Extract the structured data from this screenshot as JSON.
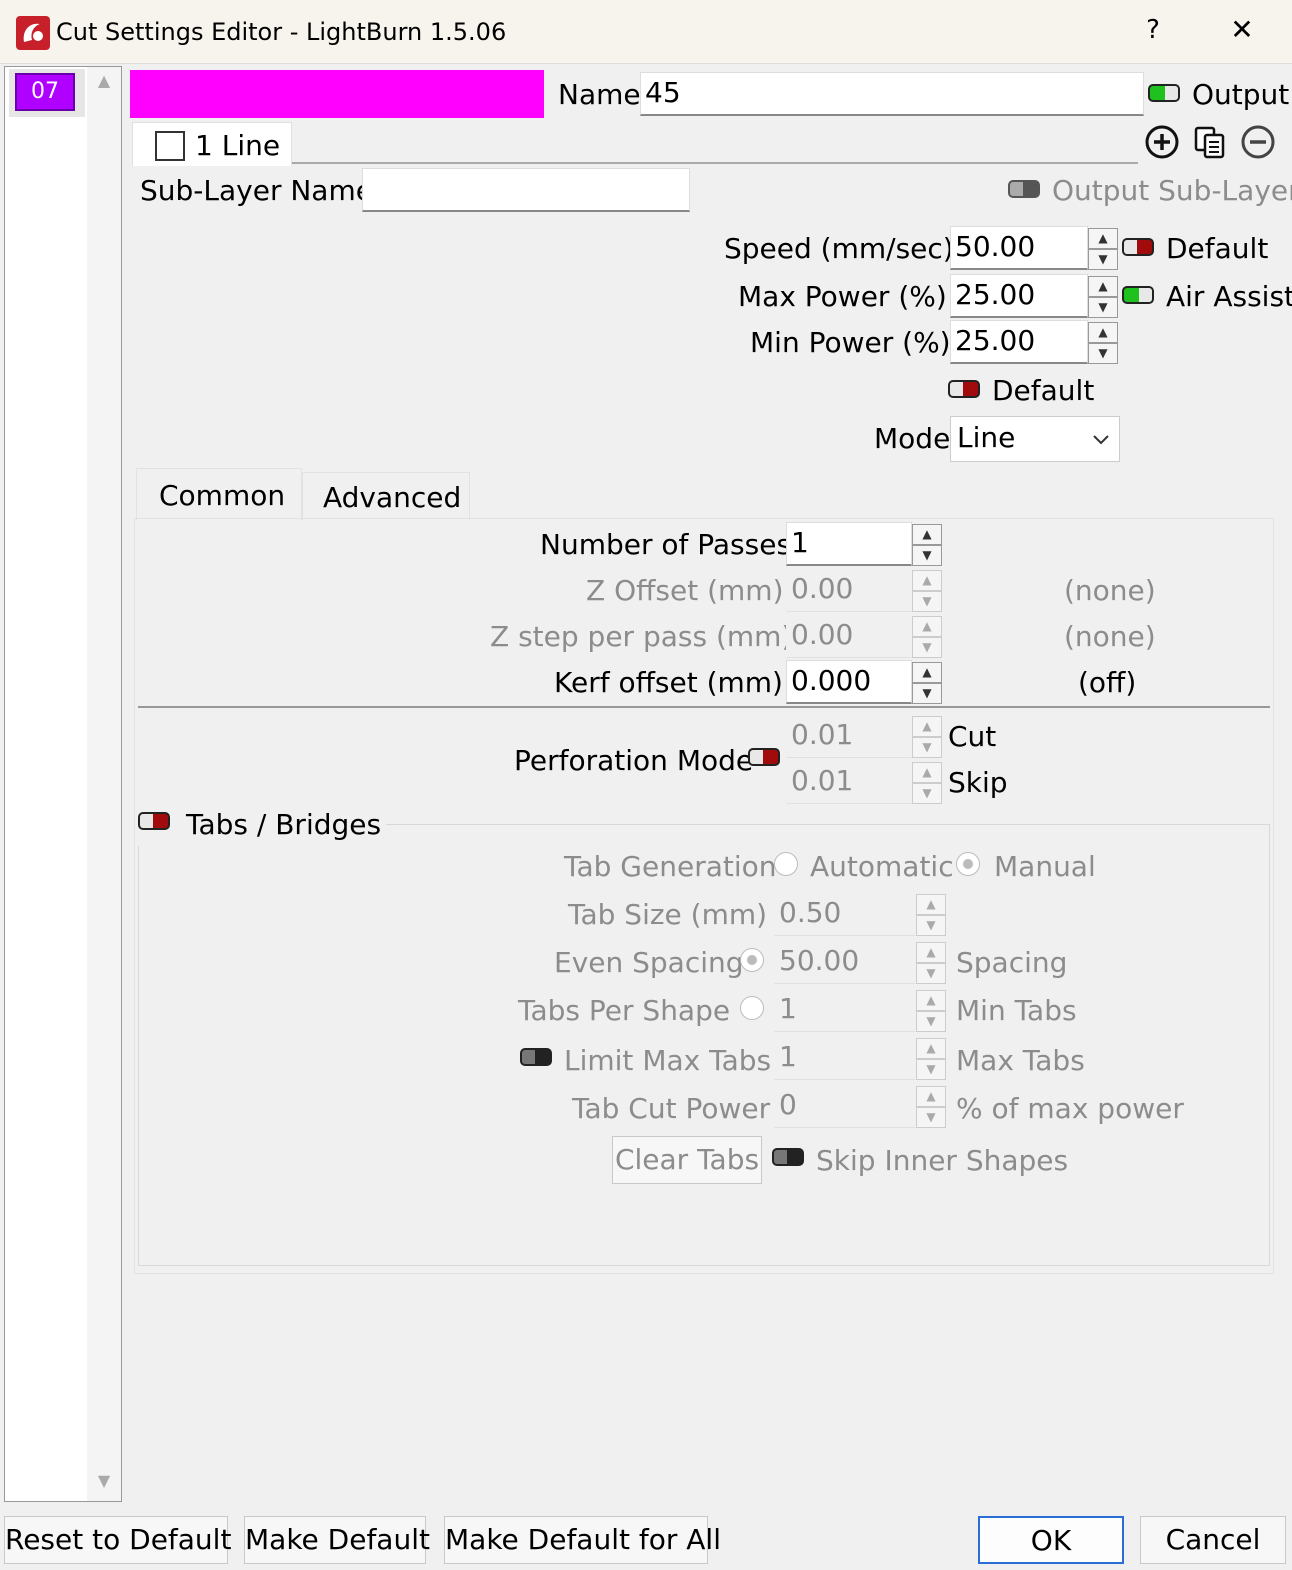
{
  "window": {
    "title": "Cut Settings Editor - LightBurn 1.5.06",
    "help": "?",
    "close": "✕"
  },
  "layer_list": {
    "items": [
      "07"
    ],
    "scroll_up": "▲",
    "scroll_down": "▼"
  },
  "header": {
    "layer_color": "#ff00ff",
    "name_label": "Name",
    "name_value": "45",
    "output_label": "Output"
  },
  "sublayer": {
    "tab_label": "1 Line",
    "name_label": "Sub-Layer Name",
    "name_value": "",
    "output_label": "Output Sub-Layer"
  },
  "speed": {
    "label": "Speed (mm/sec)",
    "value": "50.00",
    "default_label": "Default"
  },
  "max_power": {
    "label": "Max Power (%)",
    "value": "25.00",
    "air_assist_label": "Air Assist"
  },
  "min_power": {
    "label": "Min Power (%)",
    "value": "25.00"
  },
  "power_default_label": "Default",
  "mode": {
    "label": "Mode",
    "value": "Line"
  },
  "tabs": [
    "Common",
    "Advanced"
  ],
  "passes": {
    "label": "Number of Passes",
    "value": "1"
  },
  "z_offset": {
    "label": "Z Offset (mm)",
    "value": "0.00",
    "status": "(none)"
  },
  "z_step": {
    "label": "Z step per pass (mm)",
    "value": "0.00",
    "status": "(none)"
  },
  "kerf": {
    "label": "Kerf offset (mm)",
    "value": "0.000",
    "status": "(off)"
  },
  "perforation": {
    "label": "Perforation Mode",
    "cut_value": "0.01",
    "cut_label": "Cut",
    "skip_value": "0.01",
    "skip_label": "Skip"
  },
  "tabs_bridges": {
    "label": "Tabs / Bridges",
    "generation_label": "Tab Generation",
    "automatic_label": "Automatic",
    "manual_label": "Manual",
    "size_label": "Tab Size (mm)",
    "size_value": "0.50",
    "even_spacing_label": "Even Spacing",
    "spacing_value": "50.00",
    "spacing_label": "Spacing",
    "per_shape_label": "Tabs Per Shape",
    "per_shape_value": "1",
    "min_tabs_label": "Min Tabs",
    "limit_max_label": "Limit Max Tabs",
    "max_value": "1",
    "max_tabs_label": "Max Tabs",
    "cut_power_label": "Tab Cut Power",
    "cut_power_value": "0",
    "cut_power_unit": "% of max power",
    "clear_tabs_label": "Clear Tabs",
    "skip_inner_label": "Skip Inner Shapes"
  },
  "footer": {
    "reset": "Reset to Default",
    "make_default": "Make Default",
    "make_default_all": "Make Default for All",
    "ok": "OK",
    "cancel": "Cancel"
  }
}
